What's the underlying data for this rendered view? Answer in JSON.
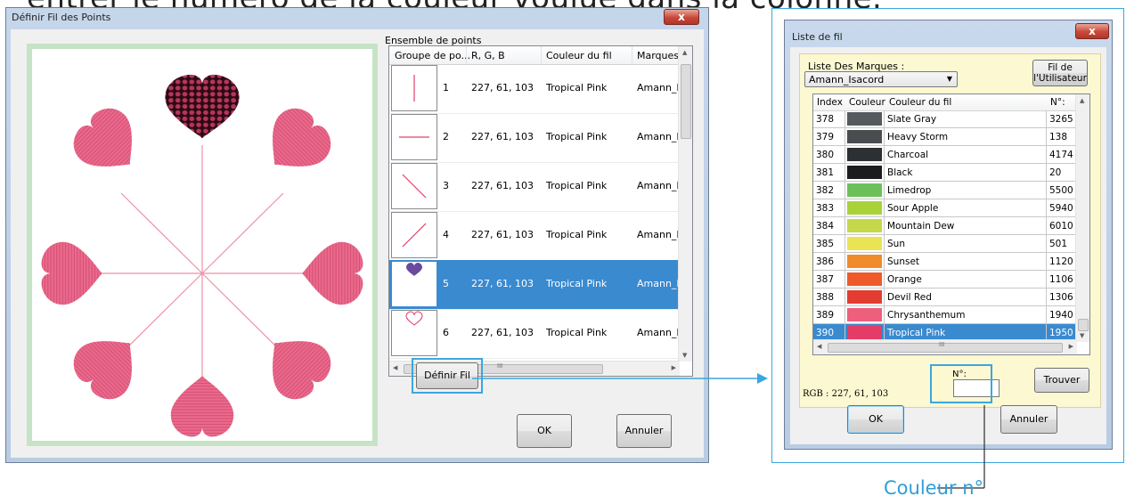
{
  "top_caption": "entrer le numéro de la couleur voulue dans la colonne.",
  "window1": {
    "title": "Définir Fil des Points",
    "close_label": "x",
    "group_label": "Ensemble de points",
    "columns": [
      "Groupe de po...",
      "R, G, B",
      "Couleur du fil",
      "Marques"
    ],
    "rows": [
      {
        "num": "1",
        "rgb": "227, 61, 103",
        "color": "Tropical Pink",
        "brand": "Amann_Isa",
        "icon": "vertical-line-icon"
      },
      {
        "num": "2",
        "rgb": "227, 61, 103",
        "color": "Tropical Pink",
        "brand": "Amann_Isa",
        "icon": "horizontal-line-icon"
      },
      {
        "num": "3",
        "rgb": "227, 61, 103",
        "color": "Tropical Pink",
        "brand": "Amann_Isa",
        "icon": "diagonal-down-line-icon"
      },
      {
        "num": "4",
        "rgb": "227, 61, 103",
        "color": "Tropical Pink",
        "brand": "Amann_Isa",
        "icon": "diagonal-up-line-icon"
      },
      {
        "num": "5",
        "rgb": "227, 61, 103",
        "color": "Tropical Pink",
        "brand": "Amann_Isa",
        "icon": "filled-heart-icon",
        "selected": true
      },
      {
        "num": "6",
        "rgb": "227, 61, 103",
        "color": "Tropical Pink",
        "brand": "Amann_Isa",
        "icon": "outline-heart-icon"
      }
    ],
    "scroll_mid": "III",
    "define_thread_button": "Définir Fil",
    "ok_button": "OK",
    "cancel_button": "Annuler"
  },
  "window2": {
    "title": "Liste de fil",
    "close_label": "x",
    "brand_list_label": "Liste Des Marques :",
    "brand_selected": "Amann_Isacord",
    "user_thread_button_line1": "Fil de",
    "user_thread_button_line2": "l'Utilisateur",
    "columns": [
      "Index",
      "Couleur",
      "Couleur du fil",
      "N°:"
    ],
    "rows": [
      {
        "index": "378",
        "swatch": "#555a5e",
        "name": "Slate Gray",
        "num": "3265"
      },
      {
        "index": "379",
        "swatch": "#4a4d50",
        "name": "Heavy Storm",
        "num": "138"
      },
      {
        "index": "380",
        "swatch": "#2c3032",
        "name": "Charcoal",
        "num": "4174"
      },
      {
        "index": "381",
        "swatch": "#1b1c1d",
        "name": "Black",
        "num": "20"
      },
      {
        "index": "382",
        "swatch": "#6cc05a",
        "name": "Limedrop",
        "num": "5500"
      },
      {
        "index": "383",
        "swatch": "#a9d13a",
        "name": "Sour Apple",
        "num": "5940"
      },
      {
        "index": "384",
        "swatch": "#c4d84a",
        "name": "Mountain Dew",
        "num": "6010"
      },
      {
        "index": "385",
        "swatch": "#e8e454",
        "name": "Sun",
        "num": "501"
      },
      {
        "index": "386",
        "swatch": "#f08c2c",
        "name": "Sunset",
        "num": "1120"
      },
      {
        "index": "387",
        "swatch": "#ee5a2a",
        "name": "Orange",
        "num": "1106"
      },
      {
        "index": "388",
        "swatch": "#e33d32",
        "name": "Devil Red",
        "num": "1306"
      },
      {
        "index": "389",
        "swatch": "#ee5f7c",
        "name": "Chrysanthemum",
        "num": "1940"
      },
      {
        "index": "390",
        "swatch": "#e33d67",
        "name": "Tropical Pink",
        "num": "1950",
        "selected": true
      }
    ],
    "scroll_mid": "III",
    "rgb_text": "RGB : 227, 61, 103",
    "number_label": "N°:",
    "number_value": "",
    "find_button": "Trouver",
    "ok_button": "OK",
    "cancel_button": "Annuler"
  },
  "caption_bottom": "Couleur n°",
  "colors": {
    "accent": "#3aa7e0",
    "selection": "#3a8ad0",
    "thread_pink": "#e33d67"
  }
}
